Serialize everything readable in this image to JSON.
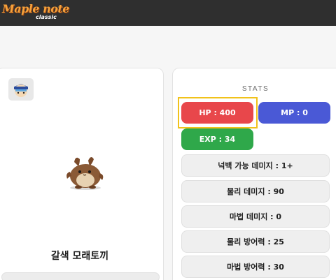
{
  "header": {
    "logo_main": "Maple note",
    "logo_sub": "classic"
  },
  "monster": {
    "name": "갈색 모래토끼"
  },
  "stats": {
    "title": "STATS",
    "hp": "HP : 400",
    "mp": "MP : 0",
    "exp": "EXP : 34",
    "rows": [
      "넉백 가능 데미지 : 1+",
      "물리 데미지 : 90",
      "마법 데미지 : 0",
      "물리 방어력 : 25",
      "마법 방어력 : 30"
    ]
  },
  "colors": {
    "hp": "#e8474b",
    "mp": "#4a59d6",
    "exp": "#2fa84a",
    "highlight": "#f1c21b",
    "topbar": "#2f2f2f"
  },
  "icons": [
    "monster-portrait-icon",
    "monster-sprite"
  ]
}
